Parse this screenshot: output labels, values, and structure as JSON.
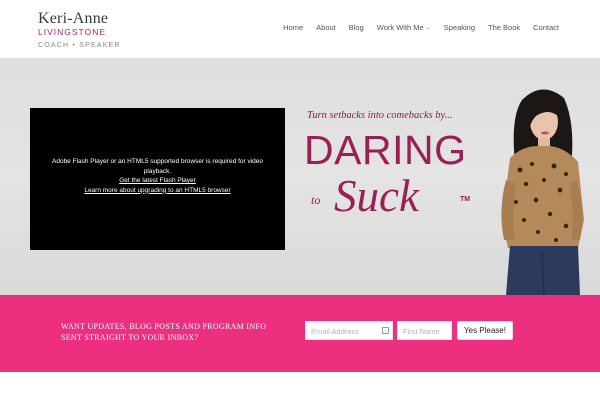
{
  "brand": {
    "name": "Keri-Anne",
    "surname": "LIVINGSTONE",
    "role": "COACH • SPEAKER",
    "accent": "#b5216b"
  },
  "nav": {
    "items": [
      "Home",
      "About",
      "Blog",
      "Work With Me",
      "Speaking",
      "The Book",
      "Contact"
    ]
  },
  "hero": {
    "video": {
      "message": "Adobe Flash Player or an HTML5 supported browser is required for video playback.",
      "link_flash": "Get the latest Flash Player",
      "link_html5": "Learn more about upgrading to an HTML5 browser"
    },
    "tagline": "Turn setbacks into comebacks by...",
    "title_main": "DARING",
    "title_to": "to",
    "title_end": "Suck",
    "trademark": "TM",
    "title_color": "#9a1f55"
  },
  "signup": {
    "text": "WANT UPDATES, BLOG POSTS AND PROGRAM INFO SENT STRAIGHT TO YOUR INBOX?",
    "email_placeholder": "Email Address",
    "first_name_placeholder": "First Name",
    "submit_label": "Yes Please!",
    "bar_color": "#ec2f7f"
  }
}
